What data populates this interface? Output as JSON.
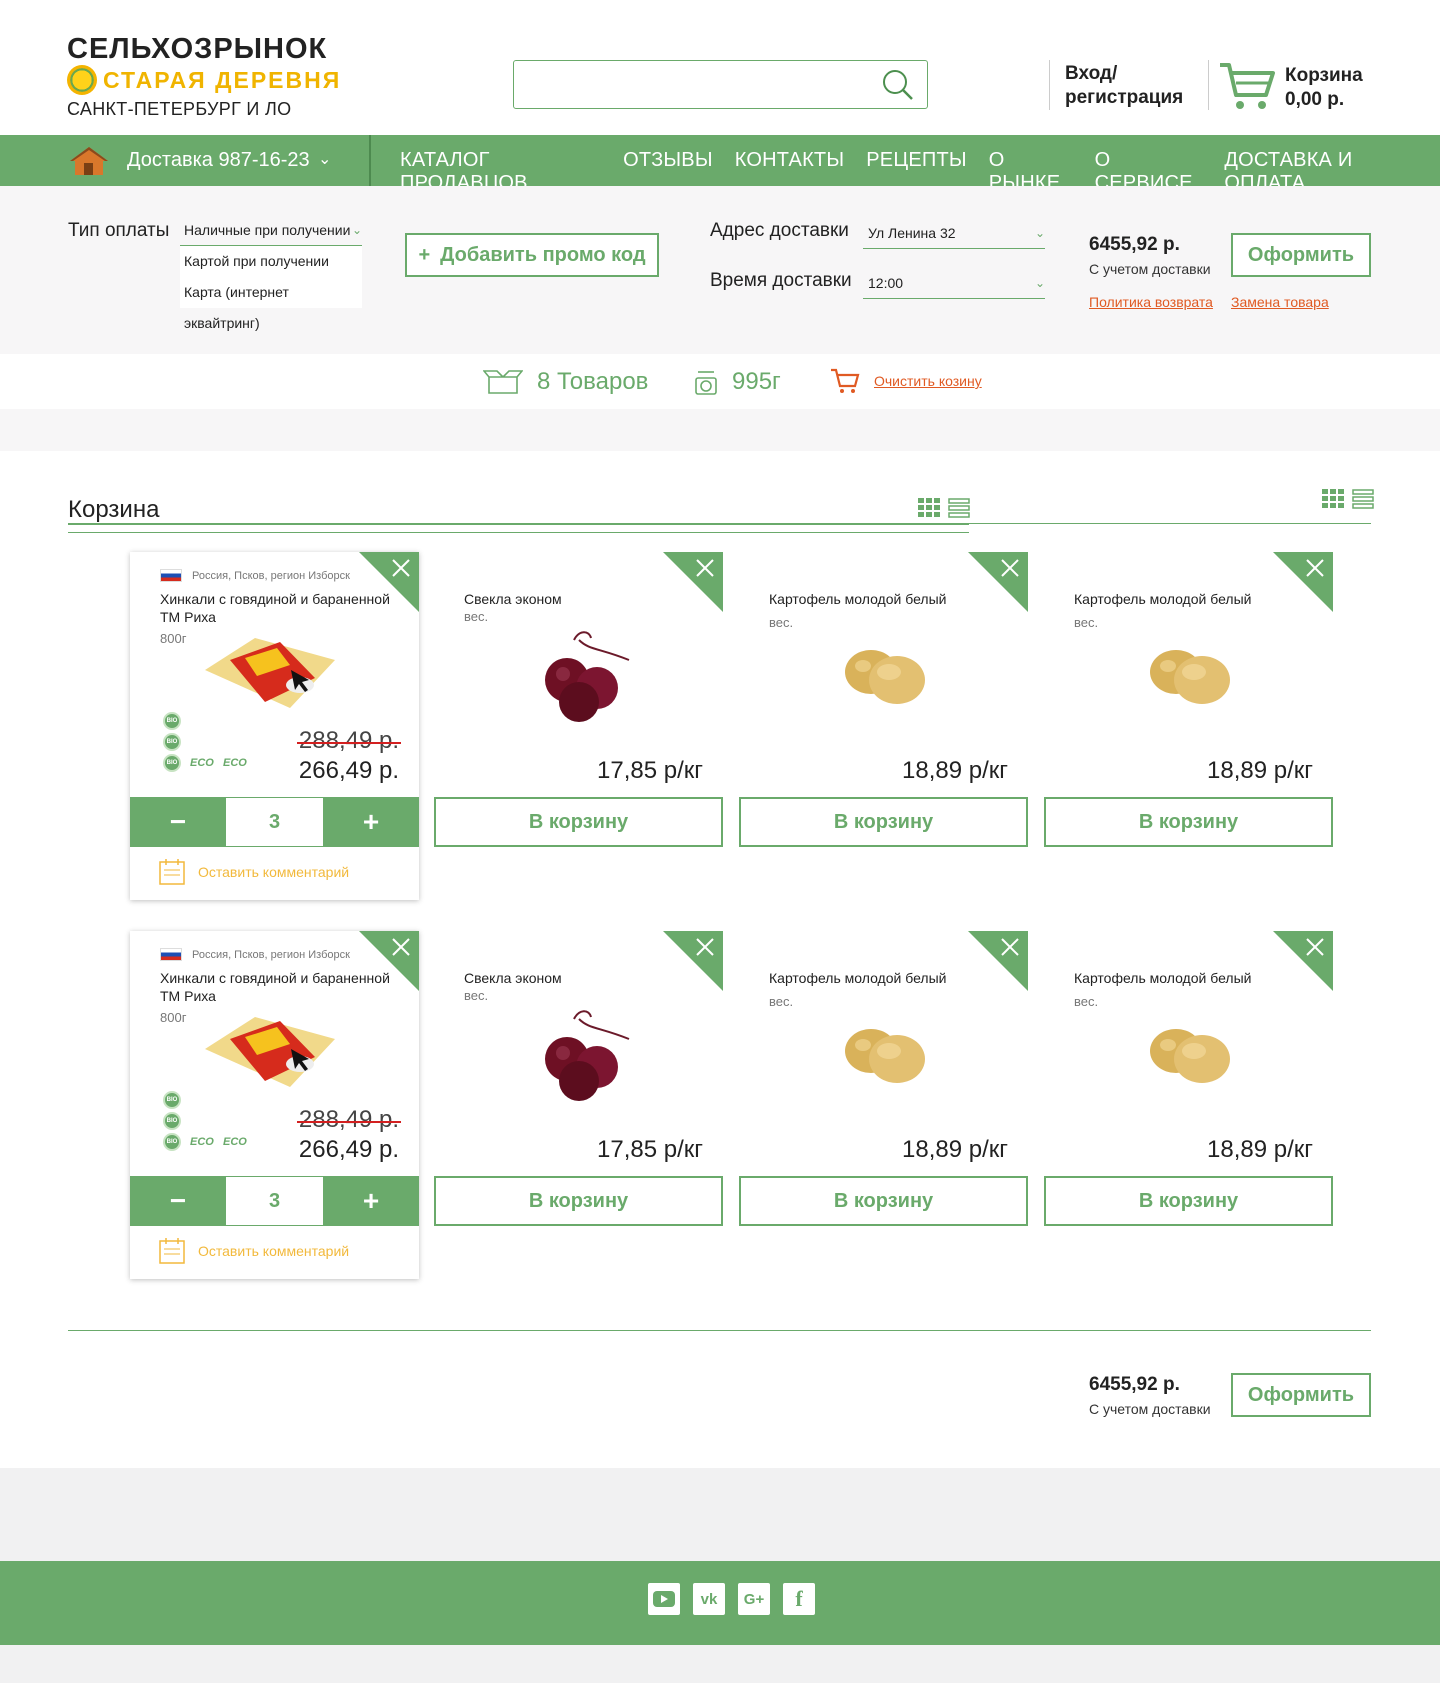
{
  "header": {
    "logo_line1": "СЕЛЬХОЗРЫНОК",
    "logo_line2": "СТАРАЯ ДЕРЕВНЯ",
    "logo_line3": "САНКТ-ПЕТЕРБУРГ И ЛО",
    "search_placeholder": "",
    "login_line1": "Вход/",
    "login_line2": "регистрация",
    "cart_label": "Корзина",
    "cart_total": "0,00 р."
  },
  "nav": {
    "delivery": "Доставка  987-16-23",
    "items": [
      "КАТАЛОГ ПРОДАВЦОВ",
      "ОТЗЫВЫ",
      "КОНТАКТЫ",
      "РЕЦЕПТЫ",
      "О РЫНКЕ",
      "О СЕРВИСЕ",
      "ДОСТАВКА И ОПЛАТА"
    ]
  },
  "options": {
    "payment_label": "Тип оплаты",
    "payment_options": [
      "Наличные при получении",
      "Картой при получении",
      "Карта (интернет эквайтринг)"
    ],
    "promo_label": "Добавить промо код",
    "address_label": "Адрес доставки",
    "address_value": "Ул Ленина 32",
    "time_label": "Время доставки",
    "time_value": "12:00",
    "total": "6455,92 р.",
    "total_note": "С учетом доставки",
    "checkout": "Оформить",
    "return_policy": "Политика возврата",
    "replace": "Замена товара"
  },
  "summary": {
    "items_count": "8  Товаров",
    "weight": "995г",
    "clear": "Очистить козину"
  },
  "cart": {
    "title": "Корзина",
    "rows": [
      {
        "active": {
          "origin": "Россия, Псков, регион Изборск",
          "name": "Хинкали с говядиной и бараненной ТМ Риха",
          "weight": "800г",
          "old_price": "288,49 р.",
          "price": "266,49 р.",
          "qty": "3",
          "minus": "−",
          "plus": "+",
          "comment": "Оставить комментарий"
        },
        "items": [
          {
            "name": "Свекла эконом",
            "unit": "вес.",
            "price": "17,85 р/кг",
            "button": "В корзину",
            "kind": "beet"
          },
          {
            "name": "Картофель молодой белый",
            "unit": "вес.",
            "price": "18,89 р/кг",
            "button": "В корзину",
            "kind": "potato"
          },
          {
            "name": "Картофель молодой белый",
            "unit": "вес.",
            "price": "18,89 р/кг",
            "button": "В корзину",
            "kind": "potato"
          }
        ]
      },
      {
        "active": {
          "origin": "Россия, Псков, регион Изборск",
          "name": "Хинкали с говядиной и бараненной ТМ Риха",
          "weight": "800г",
          "old_price": "288,49 р.",
          "price": "266,49 р.",
          "qty": "3",
          "minus": "−",
          "plus": "+",
          "comment": "Оставить комментарий"
        },
        "items": [
          {
            "name": "Свекла эконом",
            "unit": "вес.",
            "price": "17,85 р/кг",
            "button": "В корзину",
            "kind": "beet"
          },
          {
            "name": "Картофель молодой белый",
            "unit": "вес.",
            "price": "18,89 р/кг",
            "button": "В корзину",
            "kind": "potato"
          },
          {
            "name": "Картофель молодой белый",
            "unit": "вес.",
            "price": "18,89 р/кг",
            "button": "В корзину",
            "kind": "potato"
          }
        ]
      }
    ],
    "bottom_total": "6455,92 р.",
    "bottom_note": "С учетом доставки",
    "bottom_checkout": "Оформить"
  },
  "badges": {
    "bio": "BIO",
    "eco": "ECO"
  },
  "footer": {
    "socials": [
      "youtube-icon",
      "vk-icon",
      "google-plus-icon",
      "facebook-icon"
    ],
    "vk_label": "vk",
    "gplus_label": "G+",
    "fb_label": "f"
  },
  "colors": {
    "accent": "#6aaa6b",
    "orange": "#e05a23",
    "yellow": "#f0b400"
  }
}
